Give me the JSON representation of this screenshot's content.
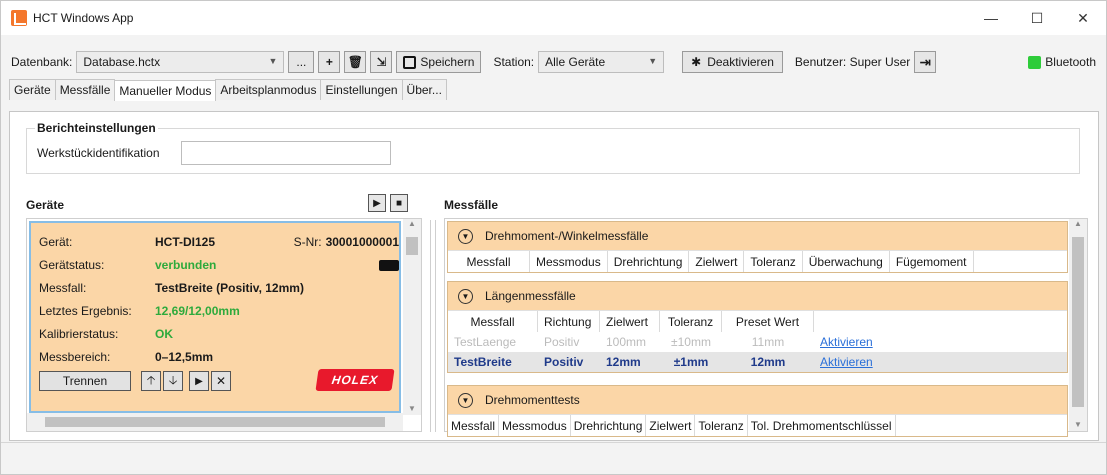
{
  "window": {
    "title": "HCT Windows App",
    "minimize": "—",
    "maximize": "☐",
    "close": "✕"
  },
  "toolbar": {
    "db_label": "Datenbank:",
    "db_value": "Database.hctx",
    "browse_label": "...",
    "add_label": "+",
    "delete_label": "🗑",
    "import_label": "⇲",
    "save_label": "Speichern",
    "station_label": "Station:",
    "station_value": "Alle Geräte",
    "bt_symbol": "✱",
    "deactivate_label": "Deaktivieren",
    "user_label": "Benutzer: Super User",
    "logout_symbol": "⇥",
    "bluetooth_label": "Bluetooth"
  },
  "tabs": [
    "Geräte",
    "Messfälle",
    "Manueller Modus",
    "Arbeitsplanmodus",
    "Einstellungen",
    "Über..."
  ],
  "report": {
    "title": "Berichteinstellungen",
    "workpiece_label": "Werkstückidentifikation",
    "workpiece_value": ""
  },
  "devices": {
    "title": "Geräte",
    "card": {
      "device_label": "Gerät:",
      "device_value": "HCT-DI125",
      "serial_label": "S-Nr:",
      "serial_value": "30001000001",
      "status_label": "Gerätstatus:",
      "status_value": "verbunden",
      "case_label": "Messfall:",
      "case_value": "TestBreite (Positiv, 12mm)",
      "last_label": "Letztes Ergebnis:",
      "last_value": "12,69/12,00mm",
      "cal_label": "Kalibrierstatus:",
      "cal_value": "OK",
      "range_label": "Messbereich:",
      "range_value": "0–12,5mm",
      "disconnect_label": "Trennen",
      "up_symbol": "🡡",
      "down_symbol": "🡣",
      "play_symbol": "▶",
      "remove_symbol": "✕",
      "brand": "HOLEX"
    }
  },
  "cases": {
    "title": "Messfälle",
    "torque": {
      "title": "Drehmoment-/Winkelmessfälle",
      "columns": [
        "Messfall",
        "Messmodus",
        "Drehrichtung",
        "Zielwert",
        "Toleranz",
        "Überwachung",
        "Fügemoment"
      ]
    },
    "length": {
      "title": "Längenmessfälle",
      "columns": [
        "Messfall",
        "Richtung",
        "Zielwert",
        "Toleranz",
        "Preset Wert"
      ],
      "rows": [
        {
          "name": "TestLaenge",
          "dir": "Positiv",
          "target": "100mm",
          "tol": "±10mm",
          "preset": "11mm",
          "action": "Aktivieren"
        },
        {
          "name": "TestBreite",
          "dir": "Positiv",
          "target": "12mm",
          "tol": "±1mm",
          "preset": "12mm",
          "action": "Aktivieren"
        }
      ]
    },
    "tests": {
      "title": "Drehmomenttests",
      "columns": [
        "Messfall",
        "Messmodus",
        "Drehrichtung",
        "Zielwert",
        "Toleranz",
        "Tol. Drehmomentschlüssel"
      ]
    }
  },
  "colors": {
    "accent_orange": "#fbd6a7",
    "status_green": "#2eaa3c",
    "bluetooth_green": "#2ecc3a",
    "holex_red": "#e8192c"
  }
}
